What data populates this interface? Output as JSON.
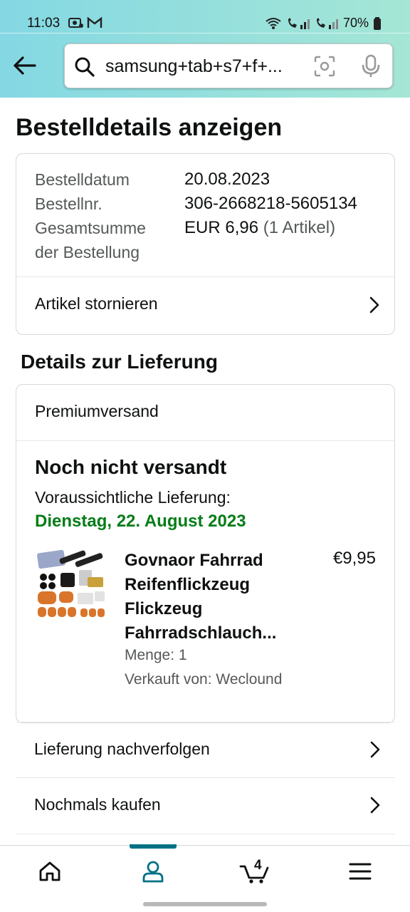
{
  "status_bar": {
    "time": "11:03",
    "battery": "70%"
  },
  "search": {
    "query": "samsung+tab+s7+f+..."
  },
  "page": {
    "title": "Bestelldetails anzeigen"
  },
  "order": {
    "date_label": "Bestelldatum",
    "date_value": "20.08.2023",
    "number_label": "Bestellnr.",
    "number_value": "306-2668218-5605134",
    "total_label_line1": "Gesamtsumme",
    "total_label_line2": "der Bestellung",
    "total_value": "EUR 6,96",
    "total_items": "(1 Artikel)",
    "cancel_label": "Artikel stornieren"
  },
  "delivery": {
    "section_title": "Details zur Lieferung",
    "shipping_type": "Premiumversand",
    "status": "Noch nicht versandt",
    "expected_label": "Voraussichtliche Lieferung:",
    "expected_date": "Dienstag, 22. August 2023",
    "product": {
      "name": "Govnaor Fahrrad Reifenflickzeug Flickzeug Fahrradschlauch...",
      "price": "€9,95",
      "quantity": "Menge: 1",
      "seller": "Verkauft von: Weclound"
    }
  },
  "actions": {
    "track": "Lieferung nachverfolgen",
    "buy_again": "Nochmals kaufen"
  },
  "bottom_nav": {
    "items": [
      "home-icon",
      "account-icon",
      "cart-icon",
      "menu-icon"
    ],
    "active": "account",
    "cart_count": "4",
    "accent": "#007185"
  },
  "colors": {
    "delivery_green": "#067d18",
    "header_gradient_start": "#84d8e3",
    "header_gradient_end": "#a5e6d6"
  }
}
